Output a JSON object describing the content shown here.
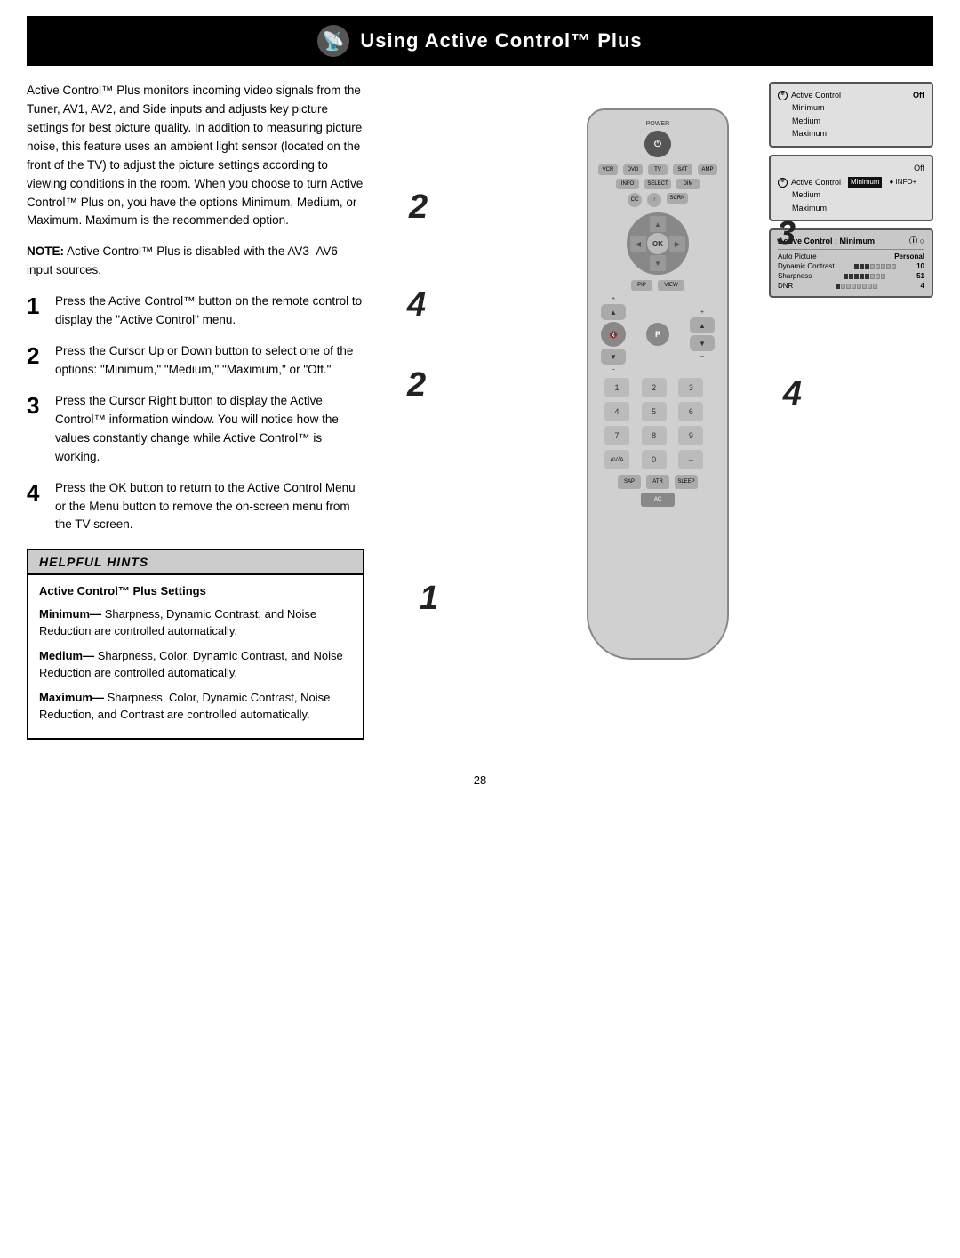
{
  "header": {
    "title": "Using Active Control™ Plus",
    "icon": "📡"
  },
  "body_text": "Active Control™ Plus monitors incoming video signals from the Tuner, AV1, AV2, and Side inputs and adjusts key picture settings for best picture quality. In addition to measuring picture noise, this feature uses an ambient light sensor (located on the front of the TV) to adjust the picture settings according to viewing conditions in the room. When you choose to turn Active Control™ Plus on, you have the options Minimum, Medium, or Maximum. Maximum is the recommended option.",
  "note_text": "NOTE: Active Control™ Plus is disabled with the AV3–AV6 input sources.",
  "steps": [
    {
      "number": "1",
      "text": "Press the Active Control™ button on the remote control to display the \"Active Control\" menu."
    },
    {
      "number": "2",
      "text": "Press the Cursor Up or Down button to select one of the options: \"Minimum,\" \"Medium,\" \"Maximum,\" or \"Off.\""
    },
    {
      "number": "3",
      "text": "Press the Cursor Right button to display the Active Control™ information window. You will notice how the values constantly change while Active Control™ is working."
    },
    {
      "number": "4",
      "text": "Press the OK button to return to the Active Control Menu or the Menu button to remove the on-screen menu from the TV screen."
    }
  ],
  "helpful_hints": {
    "header": "Helpful Hints",
    "section_title": "Active Control™ Plus Settings",
    "items": [
      {
        "bold": "Minimum—",
        "text": "Sharpness, Dynamic Contrast, and Noise Reduction are controlled automatically."
      },
      {
        "bold": "Medium—",
        "text": "Sharpness, Color, Dynamic Contrast, and Noise Reduction are controlled automatically."
      },
      {
        "bold": "Maximum—",
        "text": "Sharpness, Color, Dynamic Contrast, Noise Reduction, and Contrast are controlled automatically."
      }
    ]
  },
  "screen1": {
    "label": "Active Control",
    "options": [
      "Off",
      "Minimum",
      "Medium",
      "Maximum"
    ]
  },
  "screen2": {
    "label": "Active Control",
    "options": [
      "Off",
      "Minimum",
      "Medium",
      "Maximum"
    ],
    "selected": "Minimum",
    "right_label": "INFO+"
  },
  "screen3": {
    "title": "Active Control : Minimum",
    "auto_picture": "Personal",
    "dynamic_contrast_val": "10",
    "sharpness_val": "51",
    "dnr_val": "4"
  },
  "remote": {
    "power_label": "POWER",
    "source_buttons": [
      "VCR",
      "DVD",
      "TV",
      "SAT",
      "AMP"
    ],
    "ok_label": "OK",
    "p_label": "P",
    "number_buttons": [
      "1",
      "2",
      "3",
      "4",
      "5",
      "6",
      "7",
      "8",
      "9",
      "AV/A",
      "0",
      "–"
    ]
  },
  "step_overlays": [
    "2",
    "3",
    "4",
    "2",
    "4",
    "1"
  ],
  "page_number": "28"
}
